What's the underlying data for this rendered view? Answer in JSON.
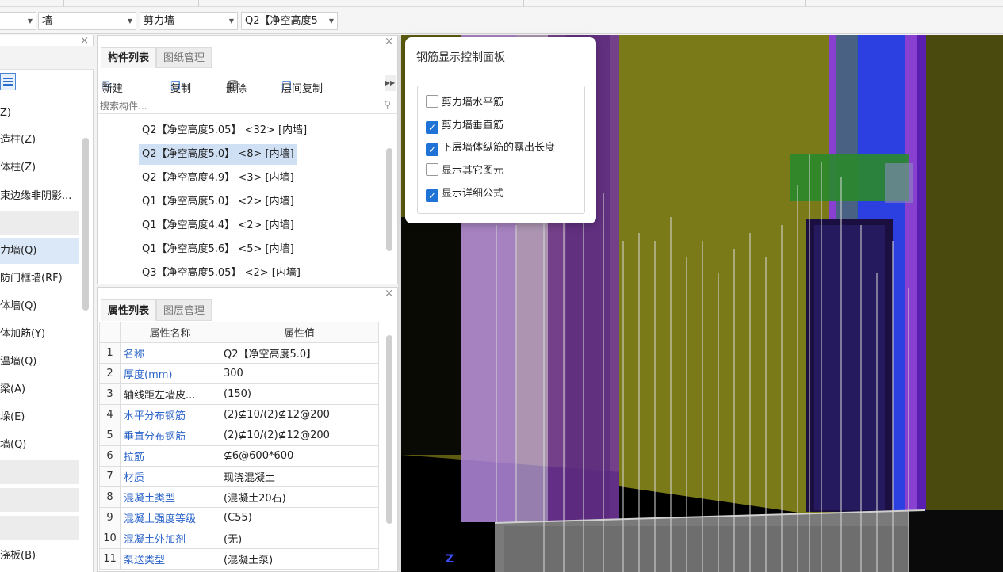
{
  "toolbar": {
    "combos": [
      {
        "label": ""
      },
      {
        "label": "墙"
      },
      {
        "label": "剪力墙"
      },
      {
        "label": "Q2【净空高度5"
      }
    ]
  },
  "leftnav": {
    "items": [
      {
        "label": "Z)"
      },
      {
        "label": "造柱(Z)"
      },
      {
        "label": "体柱(Z)"
      },
      {
        "label": "束边缘非阴影..."
      },
      {
        "label": "力墙(Q)",
        "selected": true
      },
      {
        "label": "防门框墙(RF)"
      },
      {
        "label": "体墙(Q)"
      },
      {
        "label": "体加筋(Y)"
      },
      {
        "label": "温墙(Q)"
      },
      {
        "label": "梁(A)"
      },
      {
        "label": "垛(E)"
      },
      {
        "label": "墙(Q)"
      },
      {
        "label": "浇板(B)"
      }
    ]
  },
  "component_panel": {
    "tabs": [
      "构件列表",
      "图纸管理"
    ],
    "actions": {
      "new": "新建",
      "copy": "复制",
      "delete": "删除",
      "floor_copy": "层间复制"
    },
    "search_placeholder": "搜索构件...",
    "items": [
      {
        "label": "Q2【净空高度5.05】 <32> [内墙]"
      },
      {
        "label": "Q2【净空高度5.0】 <8> [内墙]",
        "selected": true
      },
      {
        "label": "Q2【净空高度4.9】 <3> [内墙]"
      },
      {
        "label": "Q1【净空高度5.0】 <2> [内墙]"
      },
      {
        "label": "Q1【净空高度4.4】 <2> [内墙]"
      },
      {
        "label": "Q1【净空高度5.6】 <5> [内墙]"
      },
      {
        "label": "Q3【净空高度5.05】 <2> [内墙]"
      }
    ]
  },
  "property_panel": {
    "tabs": [
      "属性列表",
      "图层管理"
    ],
    "columns": [
      "属性名称",
      "属性值"
    ],
    "rows": [
      {
        "n": "1",
        "name": "名称",
        "value": "Q2【净空高度5.0】"
      },
      {
        "n": "2",
        "name": "厚度(mm)",
        "value": "300"
      },
      {
        "n": "3",
        "name": "轴线距左墙皮...",
        "value": "(150)"
      },
      {
        "n": "4",
        "name": "水平分布钢筋",
        "value": "(2)⊈10/(2)⊈12@200"
      },
      {
        "n": "5",
        "name": "垂直分布钢筋",
        "value": "(2)⊈10/(2)⊈12@200"
      },
      {
        "n": "6",
        "name": "拉筋",
        "value": "⊈6@600*600"
      },
      {
        "n": "7",
        "name": "材质",
        "value": "现浇混凝土"
      },
      {
        "n": "8",
        "name": "混凝土类型",
        "value": "(混凝土20石)"
      },
      {
        "n": "9",
        "name": "混凝土强度等级",
        "value": "(C55)"
      },
      {
        "n": "10",
        "name": "混凝土外加剂",
        "value": "(无)"
      },
      {
        "n": "11",
        "name": "泵送类型",
        "value": "(混凝土泵)"
      }
    ]
  },
  "rebar_panel": {
    "title": "钢筋显示控制面板",
    "options": [
      {
        "label": "剪力墙水平筋",
        "checked": false
      },
      {
        "label": "剪力墙垂直筋",
        "checked": true
      },
      {
        "label": "下层墙体纵筋的露出长度",
        "checked": true
      },
      {
        "label": "显示其它图元",
        "checked": false
      },
      {
        "label": "显示详细公式",
        "checked": true
      }
    ]
  },
  "viewport": {
    "axis_label": "Z"
  },
  "colors": {
    "accent": "#1f72d6",
    "link_text": "#2b64c9",
    "wall_olive": "#6b6a1a",
    "wall_purple": "#8a3fd0",
    "wall_blue": "#2a3fe0"
  }
}
